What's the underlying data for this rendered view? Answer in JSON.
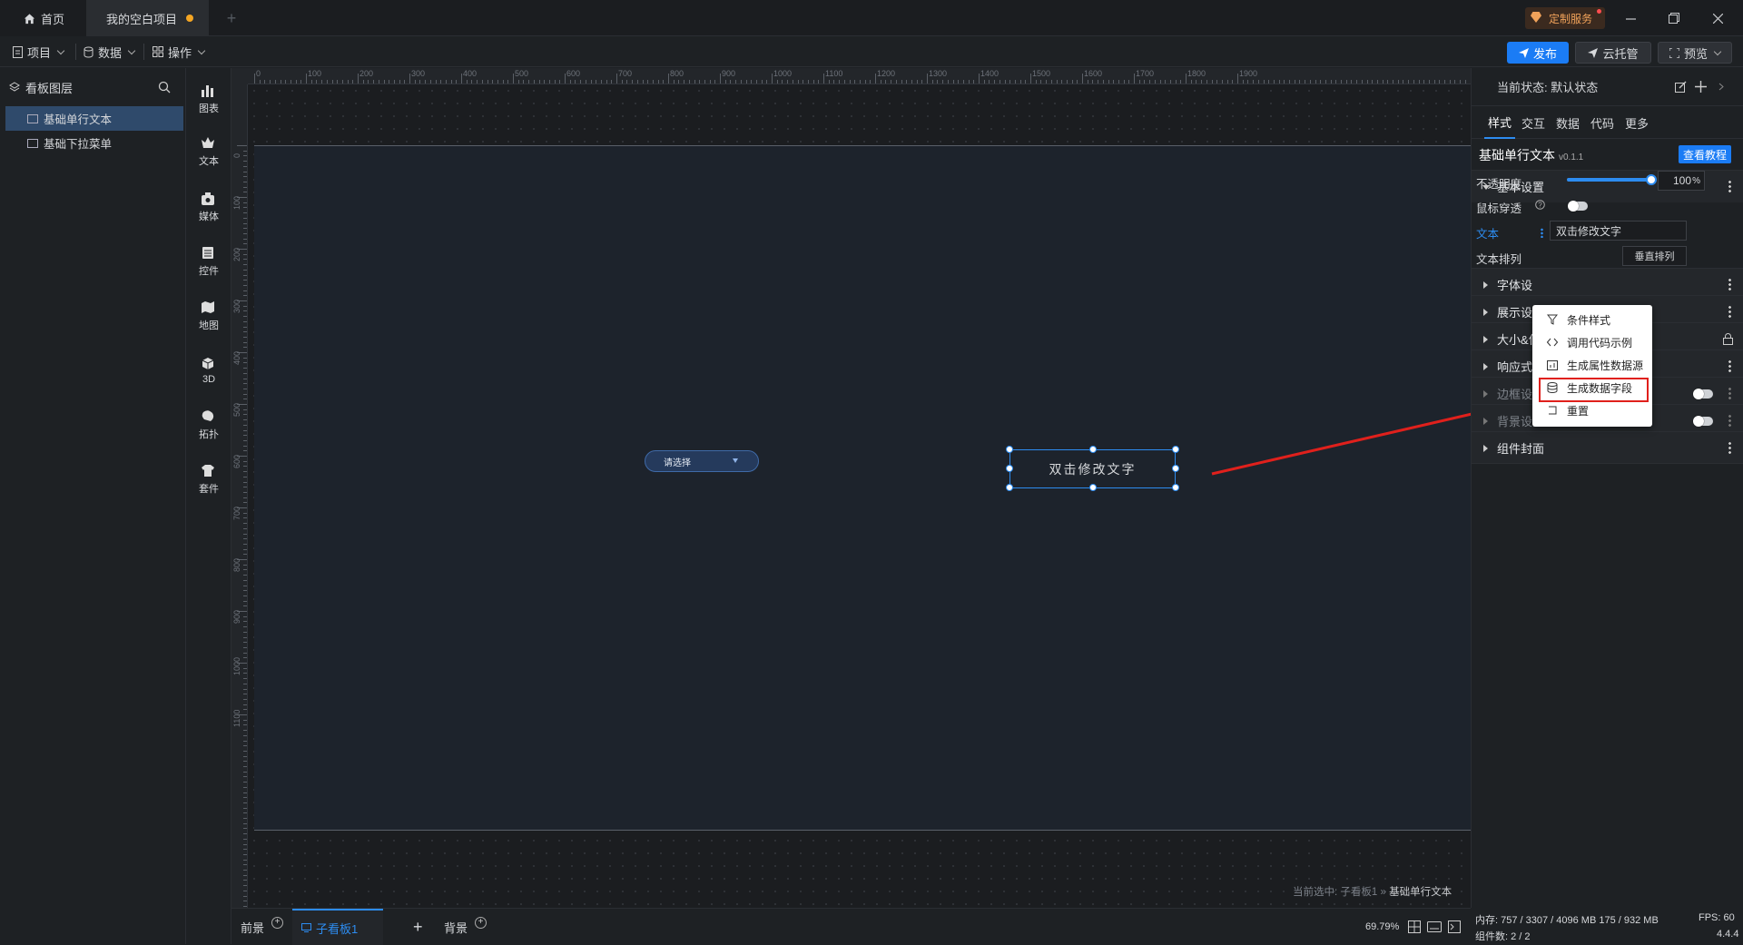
{
  "titlebar": {
    "home_tab": "首页",
    "project_tab": "我的空白项目",
    "add_tab": "+",
    "custom_service": "定制服务"
  },
  "menubar": {
    "project": "项目",
    "data": "数据",
    "operate": "操作",
    "publish": "发布",
    "cloud_host": "云托管",
    "preview": "预览"
  },
  "layers": {
    "title": "看板图层",
    "items": [
      {
        "label": "基础单行文本",
        "selected": true
      },
      {
        "label": "基础下拉菜单",
        "selected": false
      }
    ]
  },
  "components": [
    {
      "label": "图表",
      "icon": "chart-icon"
    },
    {
      "label": "文本",
      "icon": "text-icon"
    },
    {
      "label": "媒体",
      "icon": "media-icon"
    },
    {
      "label": "控件",
      "icon": "control-icon"
    },
    {
      "label": "地图",
      "icon": "map-icon"
    },
    {
      "label": "3D",
      "icon": "cube-icon"
    },
    {
      "label": "拓扑",
      "icon": "topology-icon"
    },
    {
      "label": "套件",
      "icon": "kit-icon"
    }
  ],
  "ruler": {
    "top": [
      "0",
      "100",
      "200",
      "300",
      "400",
      "500",
      "600",
      "700",
      "800",
      "900",
      "1000",
      "1100",
      "1200",
      "1300",
      "1400",
      "1500",
      "1600",
      "1700",
      "1800",
      "1900"
    ],
    "left": [
      "0",
      "100",
      "200",
      "300",
      "400",
      "500",
      "600",
      "700",
      "800",
      "900",
      "1000",
      "1100"
    ]
  },
  "canvas": {
    "select_placeholder": "请选择",
    "text_widget": "双击修改文字",
    "breadcrumb_prefix": "当前选中: 子看板1 » ",
    "breadcrumb_current": "基础单行文本"
  },
  "bottombar": {
    "foreground": "前景",
    "sub_board": "子看板1",
    "add": "+",
    "background": "背景",
    "zoom": "69.79%"
  },
  "status": {
    "memory": "内存: 757 / 3307 / 4096 MB  175 / 932 MB",
    "fps": "FPS: 60",
    "components": "组件数: 2 / 2",
    "version": "4.4.4"
  },
  "rpanel": {
    "state": "当前状态: 默认状态",
    "tabs": [
      "样式",
      "交互",
      "数据",
      "代码",
      "更多"
    ],
    "active_tab": "样式",
    "component_name": "基础单行文本",
    "component_version": "v0.1.1",
    "tutorial_button": "查看教程",
    "basic_settings": "基本设置",
    "opacity_label": "不透明度",
    "opacity_value": "100",
    "opacity_unit": "%",
    "opacity_fraction": 1.0,
    "mouse_through_label": "鼠标穿透",
    "text_label": "文本",
    "text_value": "双击修改文字",
    "text_arrange_label": "文本排列",
    "vertical_arrange": "垂直排列",
    "sections": [
      "字体设置",
      "展示设置",
      "大小&位置",
      "响应式布局",
      "边框设置",
      "背景设置",
      "组件封面"
    ],
    "sections_visible": [
      "字体设",
      "展示设",
      "大小&位",
      "响应式布局",
      "边框设置",
      "背景设置",
      "组件封面"
    ]
  },
  "context_menu": {
    "items": [
      {
        "label": "条件样式",
        "icon": "filter-icon"
      },
      {
        "label": "调用代码示例",
        "icon": "code-icon"
      },
      {
        "label": "生成属性数据源",
        "icon": "chart-data-icon"
      },
      {
        "label": "生成数据字段",
        "icon": "database-icon"
      },
      {
        "label": "重置",
        "icon": "reset-icon"
      }
    ],
    "highlighted": "生成数据字段"
  },
  "colors": {
    "accent": "#1b7cf5",
    "highlight_red": "#e0201c",
    "board_bg": "#1d232c"
  }
}
